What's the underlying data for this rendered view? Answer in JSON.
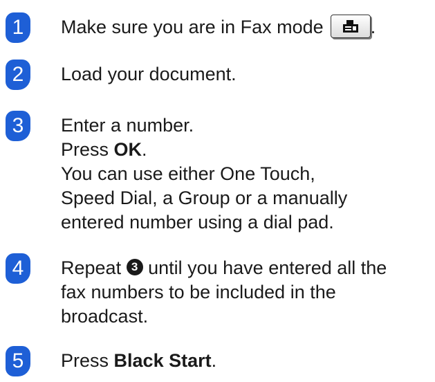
{
  "steps": [
    {
      "number": "1",
      "text": "Make sure you are in Fax mode",
      "icon": "fax-mode-icon",
      "trailing": "."
    },
    {
      "number": "2",
      "text": "Load your document."
    },
    {
      "number": "3",
      "line1": "Enter a number.",
      "press_prefix": "Press ",
      "press_key": "OK",
      "press_suffix": ".",
      "line3": "You can use either One Touch,",
      "line4": "Speed Dial, a Group or a manually",
      "line5": "entered number using a dial pad."
    },
    {
      "number": "4",
      "repeat_prefix": "Repeat ",
      "ref_step": "3",
      "repeat_suffix": " until you have entered all the",
      "line2": "fax numbers to be included in the",
      "line3": "broadcast."
    },
    {
      "number": "5",
      "press_prefix": "Press ",
      "press_key": "Black Start",
      "press_suffix": "."
    }
  ],
  "colors": {
    "badge": "#1e5fd6",
    "text": "#1a1a1a"
  }
}
